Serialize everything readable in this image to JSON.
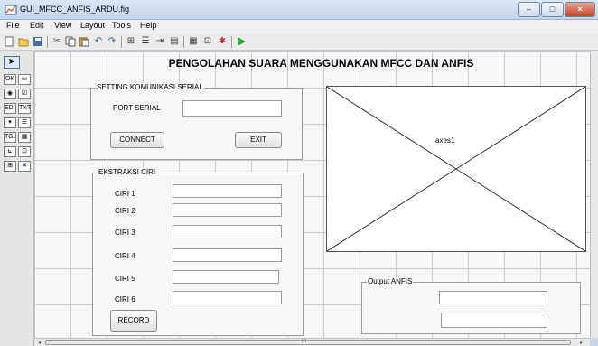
{
  "window": {
    "title": "GUI_MFCC_ANFIS_ARDU.fig",
    "controls": {
      "minimize": "–",
      "maximize": "□",
      "close": "×"
    }
  },
  "menu": [
    "File",
    "Edit",
    "View",
    "Layout",
    "Tools",
    "Help"
  ],
  "toolbar_icons": [
    "new-file-icon",
    "open-icon",
    "save-icon",
    "cut-icon",
    "copy-icon",
    "paste-icon",
    "undo-icon",
    "redo-icon",
    "align-icon",
    "menu-editor-icon",
    "tab-order-icon",
    "m-file-editor-icon",
    "property-inspector-icon",
    "object-browser-icon",
    "run-icon"
  ],
  "palette_icons": [
    "select-tool-icon",
    "push-button-icon",
    "slider-icon",
    "radio-button-icon",
    "checkbox-icon",
    "edit-text-icon",
    "static-text-icon",
    "popup-menu-icon",
    "listbox-icon",
    "toggle-button-icon",
    "table-icon",
    "axes-icon",
    "panel-icon",
    "button-group-icon",
    "activex-icon"
  ],
  "figure": {
    "title": "PENGOLAHAN SUARA MENGGUNAKAN MFCC DAN ANFIS",
    "serial_panel": {
      "title": "SETTING KOMUNIKASI SERIAL",
      "port_label": "PORT SERIAL",
      "port_value": "",
      "connect_label": "CONNECT",
      "exit_label": "EXIT"
    },
    "feature_panel": {
      "title": "EKSTRAKSI CIRI",
      "features": [
        {
          "label": "CIRI 1",
          "value": ""
        },
        {
          "label": "CIRI 2",
          "value": ""
        },
        {
          "label": "CIRI 3",
          "value": ""
        },
        {
          "label": "CIRI 4",
          "value": ""
        },
        {
          "label": "CIRI 5",
          "value": ""
        },
        {
          "label": "CIRI 6",
          "value": ""
        }
      ],
      "record_label": "RECORD"
    },
    "axes_label": "axes1",
    "output_panel": {
      "title": "Output ANFIS",
      "output1": "",
      "output2": ""
    }
  },
  "scroll": {
    "h_marker": "III"
  }
}
